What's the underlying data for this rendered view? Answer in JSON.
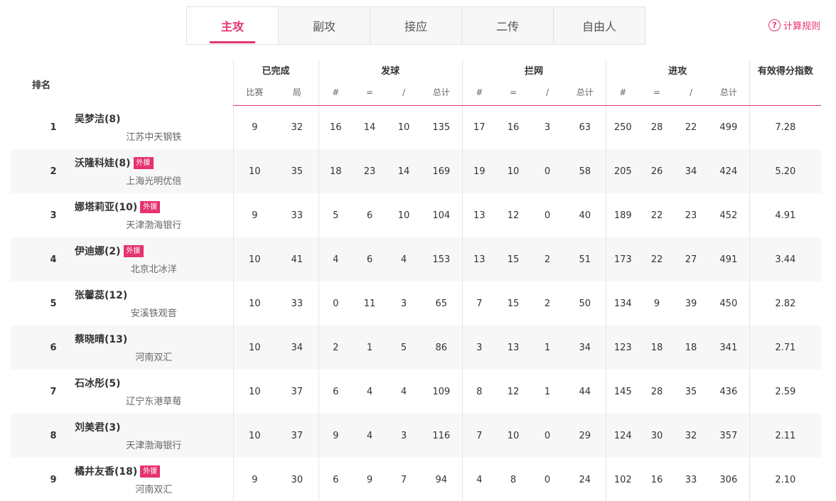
{
  "tabs": [
    {
      "label": "主攻",
      "active": true
    },
    {
      "label": "副攻",
      "active": false
    },
    {
      "label": "接应",
      "active": false
    },
    {
      "label": "二传",
      "active": false
    },
    {
      "label": "自由人",
      "active": false
    }
  ],
  "calc_rule": {
    "icon": "question-circle-icon",
    "icon_glyph": "?",
    "label": "计算规则"
  },
  "accent_color": "#e6336f",
  "table": {
    "headers": {
      "rank": "排名",
      "completed": {
        "label": "已完成",
        "sub": [
          "比赛",
          "局"
        ]
      },
      "serve": {
        "label": "发球",
        "sub": [
          "#",
          "=",
          "/",
          "总计"
        ]
      },
      "block": {
        "label": "拦网",
        "sub": [
          "#",
          "=",
          "/",
          "总计"
        ]
      },
      "attack": {
        "label": "进攻",
        "sub": [
          "#",
          "=",
          "/",
          "总计"
        ]
      },
      "index": "有效得分指数"
    },
    "rows": [
      {
        "rank": "1",
        "name": "吴梦洁(8)",
        "foreign": "",
        "team": "江苏中天钢铁",
        "matches": "9",
        "sets": "32",
        "serve": [
          "16",
          "14",
          "10",
          "135"
        ],
        "block": [
          "17",
          "16",
          "3",
          "63"
        ],
        "attack": [
          "250",
          "28",
          "22",
          "499"
        ],
        "index": "7.28"
      },
      {
        "rank": "2",
        "name": "沃隆科娃(8)",
        "foreign": "外援",
        "team": "上海光明优倍",
        "matches": "10",
        "sets": "35",
        "serve": [
          "18",
          "23",
          "14",
          "169"
        ],
        "block": [
          "19",
          "10",
          "0",
          "58"
        ],
        "attack": [
          "205",
          "26",
          "34",
          "424"
        ],
        "index": "5.20"
      },
      {
        "rank": "3",
        "name": "娜塔莉亚(10)",
        "foreign": "外援",
        "team": "天津渤海银行",
        "matches": "9",
        "sets": "33",
        "serve": [
          "5",
          "6",
          "10",
          "104"
        ],
        "block": [
          "13",
          "12",
          "0",
          "40"
        ],
        "attack": [
          "189",
          "22",
          "23",
          "452"
        ],
        "index": "4.91"
      },
      {
        "rank": "4",
        "name": "伊迪娜(2)",
        "foreign": "外援",
        "team": "北京北冰洋",
        "matches": "10",
        "sets": "41",
        "serve": [
          "4",
          "6",
          "4",
          "153"
        ],
        "block": [
          "13",
          "15",
          "2",
          "51"
        ],
        "attack": [
          "173",
          "22",
          "27",
          "491"
        ],
        "index": "3.44"
      },
      {
        "rank": "5",
        "name": "张馨蕊(12)",
        "foreign": "",
        "team": "安溪铁观音",
        "matches": "10",
        "sets": "33",
        "serve": [
          "0",
          "11",
          "3",
          "65"
        ],
        "block": [
          "7",
          "15",
          "2",
          "50"
        ],
        "attack": [
          "134",
          "9",
          "39",
          "450"
        ],
        "index": "2.82"
      },
      {
        "rank": "6",
        "name": "蔡晓晴(13)",
        "foreign": "",
        "team": "河南双汇",
        "matches": "10",
        "sets": "34",
        "serve": [
          "2",
          "1",
          "5",
          "86"
        ],
        "block": [
          "3",
          "13",
          "1",
          "34"
        ],
        "attack": [
          "123",
          "18",
          "18",
          "341"
        ],
        "index": "2.71"
      },
      {
        "rank": "7",
        "name": "石冰彤(5)",
        "foreign": "",
        "team": "辽宁东港草莓",
        "matches": "10",
        "sets": "37",
        "serve": [
          "6",
          "4",
          "4",
          "109"
        ],
        "block": [
          "8",
          "12",
          "1",
          "44"
        ],
        "attack": [
          "145",
          "28",
          "35",
          "436"
        ],
        "index": "2.59"
      },
      {
        "rank": "8",
        "name": "刘美君(3)",
        "foreign": "",
        "team": "天津渤海银行",
        "matches": "10",
        "sets": "37",
        "serve": [
          "9",
          "4",
          "3",
          "116"
        ],
        "block": [
          "7",
          "10",
          "0",
          "29"
        ],
        "attack": [
          "124",
          "30",
          "32",
          "357"
        ],
        "index": "2.11"
      },
      {
        "rank": "9",
        "name": "橘井友香(18)",
        "foreign": "外援",
        "team": "河南双汇",
        "matches": "9",
        "sets": "30",
        "serve": [
          "6",
          "9",
          "7",
          "94"
        ],
        "block": [
          "4",
          "8",
          "0",
          "24"
        ],
        "attack": [
          "102",
          "16",
          "33",
          "306"
        ],
        "index": "2.10"
      }
    ]
  }
}
